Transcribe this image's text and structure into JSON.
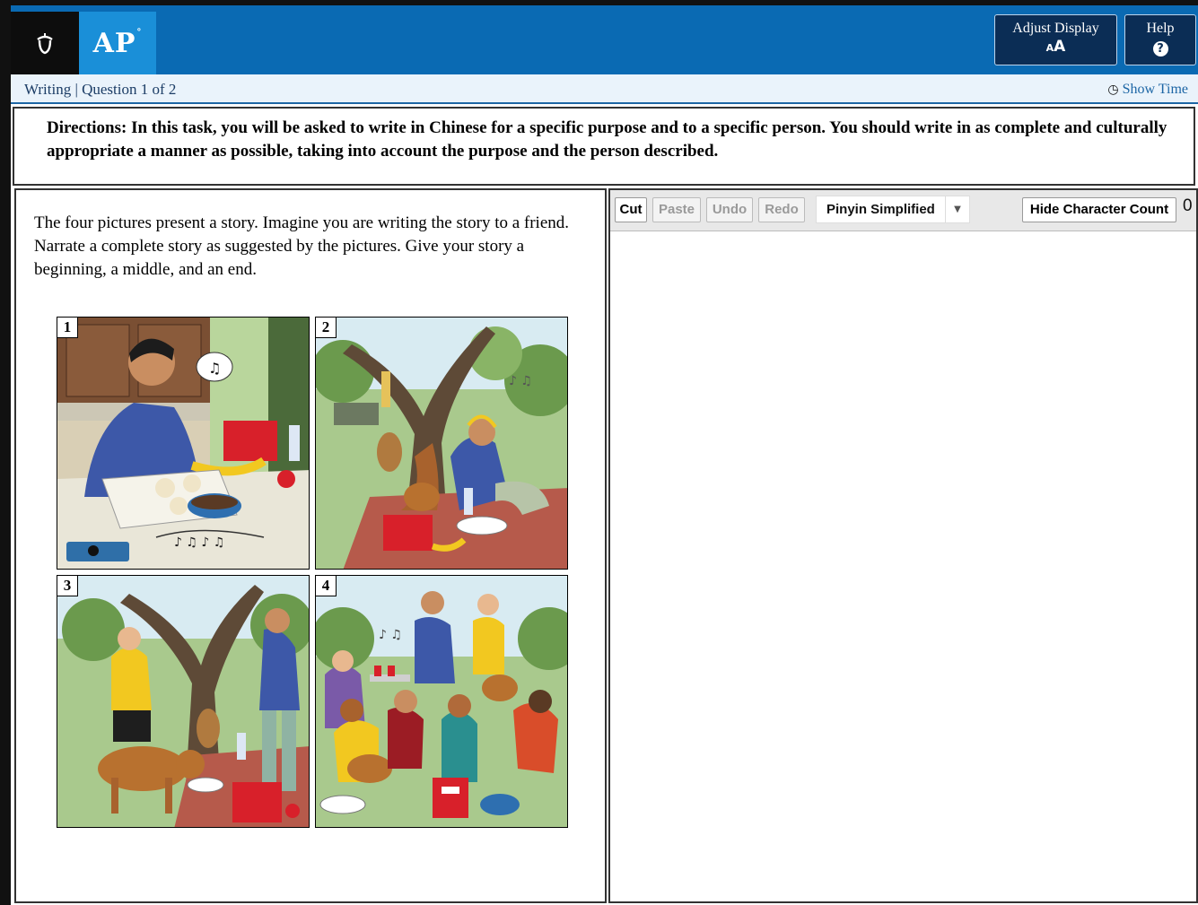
{
  "header": {
    "brand": "AP",
    "adjust_display_label": "Adjust Display",
    "adjust_display_icon_text": "AA",
    "help_label": "Help",
    "help_icon_text": "?",
    "colors": {
      "bar": "#0a6ab3",
      "brand_box": "#1a8fd8",
      "logo_box": "#0d0d0d",
      "button_bg": "#0b2d55"
    }
  },
  "status": {
    "breadcrumb": "Writing | Question 1 of 2",
    "show_time": "Show Time"
  },
  "directions": {
    "text": "Directions: In this task, you will be asked to write in Chinese for a specific purpose and to a specific person. You should write in as complete and culturally appropriate a manner as possible, taking into account the purpose and the person described."
  },
  "prompt": {
    "text": "The four pictures present a story.  Imagine you are writing the story to a friend.  Narrate a complete story as suggested by the pictures.  Give your story a beginning, a middle, and an end.",
    "panels": [
      {
        "number": "1"
      },
      {
        "number": "2"
      },
      {
        "number": "3"
      },
      {
        "number": "4"
      }
    ]
  },
  "editor": {
    "cut": "Cut",
    "paste": "Paste",
    "undo": "Undo",
    "redo": "Redo",
    "input_method": "Pinyin Simplified",
    "hide_count": "Hide Character Count",
    "character_count": "0",
    "content": ""
  }
}
